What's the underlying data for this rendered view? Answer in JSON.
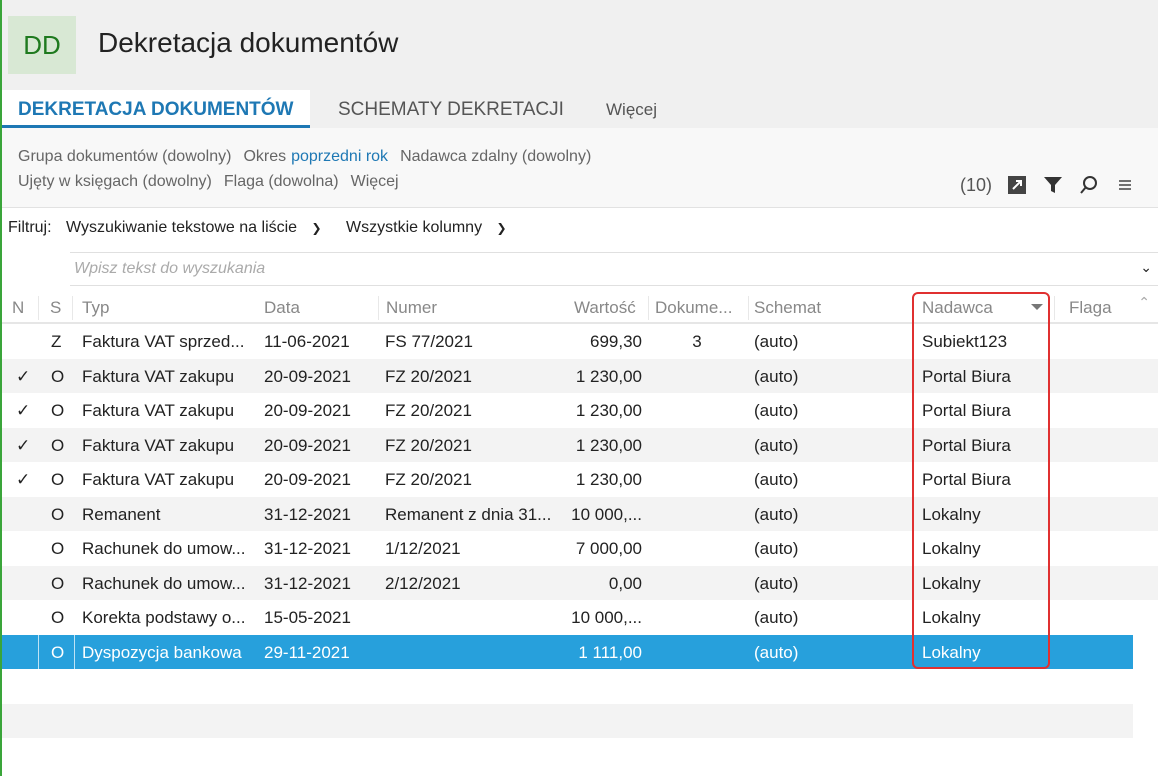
{
  "header": {
    "logo": "DD",
    "title": "Dekretacja dokumentów"
  },
  "tabs": [
    {
      "label": "DEKRETACJA DOKUMENTÓW"
    },
    {
      "label": "SCHEMATY DEKRETACJI"
    },
    {
      "label": "Więcej"
    }
  ],
  "filters": {
    "line1": {
      "group": "Grupa dokumentów (dowolny)",
      "period_label": "Okres",
      "period_value": "poprzedni rok",
      "remote_sender": "Nadawca zdalny (dowolny)"
    },
    "line2": {
      "ledger": "Ujęty w księgach (dowolny)",
      "flag": "Flaga (dowolna)",
      "more": "Więcej"
    },
    "count": "(10)"
  },
  "filter_row": {
    "label": "Filtruj:",
    "mode": "Wyszukiwanie tekstowe na liście",
    "columns": "Wszystkie kolumny",
    "search_placeholder": "Wpisz tekst do wyszukania"
  },
  "table": {
    "columns": [
      "N",
      "S",
      "Typ",
      "Data",
      "Numer",
      "Wartość",
      "Dokume...",
      "Schemat",
      "Nadawca",
      "Flaga"
    ],
    "rows": [
      {
        "n": "",
        "s": "Z",
        "typ": "Faktura VAT sprzed...",
        "data": "11-06-2021",
        "numer": "FS 77/2021",
        "wartosc": "699,30",
        "dok": "3",
        "schemat": "(auto)",
        "nadawca": "Subiekt123",
        "flaga": ""
      },
      {
        "n": "✓",
        "s": "O",
        "typ": "Faktura VAT zakupu",
        "data": "20-09-2021",
        "numer": "FZ 20/2021",
        "wartosc": "1 230,00",
        "dok": "",
        "schemat": "(auto)",
        "nadawca": "Portal Biura",
        "flaga": ""
      },
      {
        "n": "✓",
        "s": "O",
        "typ": "Faktura VAT zakupu",
        "data": "20-09-2021",
        "numer": "FZ 20/2021",
        "wartosc": "1 230,00",
        "dok": "",
        "schemat": "(auto)",
        "nadawca": "Portal Biura",
        "flaga": ""
      },
      {
        "n": "✓",
        "s": "O",
        "typ": "Faktura VAT zakupu",
        "data": "20-09-2021",
        "numer": "FZ 20/2021",
        "wartosc": "1 230,00",
        "dok": "",
        "schemat": "(auto)",
        "nadawca": "Portal Biura",
        "flaga": ""
      },
      {
        "n": "✓",
        "s": "O",
        "typ": "Faktura VAT zakupu",
        "data": "20-09-2021",
        "numer": "FZ 20/2021",
        "wartosc": "1 230,00",
        "dok": "",
        "schemat": "(auto)",
        "nadawca": "Portal Biura",
        "flaga": ""
      },
      {
        "n": "",
        "s": "O",
        "typ": "Remanent",
        "data": "31-12-2021",
        "numer": "Remanent z dnia 31...",
        "wartosc": "10 000,...",
        "dok": "",
        "schemat": "(auto)",
        "nadawca": "Lokalny",
        "flaga": ""
      },
      {
        "n": "",
        "s": "O",
        "typ": "Rachunek do umow...",
        "data": "31-12-2021",
        "numer": "1/12/2021",
        "wartosc": "7 000,00",
        "dok": "",
        "schemat": "(auto)",
        "nadawca": "Lokalny",
        "flaga": ""
      },
      {
        "n": "",
        "s": "O",
        "typ": "Rachunek do umow...",
        "data": "31-12-2021",
        "numer": "2/12/2021",
        "wartosc": "0,00",
        "dok": "",
        "schemat": "(auto)",
        "nadawca": "Lokalny",
        "flaga": ""
      },
      {
        "n": "",
        "s": "O",
        "typ": "Korekta podstawy o...",
        "data": "15-05-2021",
        "numer": "",
        "wartosc": "10 000,...",
        "dok": "",
        "schemat": "(auto)",
        "nadawca": "Lokalny",
        "flaga": ""
      },
      {
        "n": "",
        "s": "O",
        "typ": "Dyspozycja bankowa",
        "data": "29-11-2021",
        "numer": "",
        "wartosc": "1 111,00",
        "dok": "",
        "schemat": "(auto)",
        "nadawca": "Lokalny",
        "flaga": "",
        "selected": true
      }
    ]
  },
  "colors": {
    "accent": "#1e78b4",
    "selected": "#27a0dc",
    "highlight_box": "#e03030",
    "logo_bg": "#d8e8d4"
  }
}
